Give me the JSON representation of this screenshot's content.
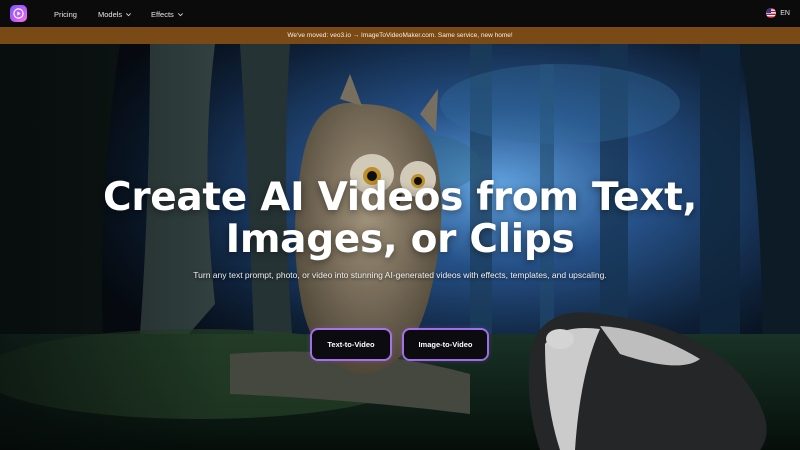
{
  "header": {
    "nav": {
      "pricing": "Pricing",
      "models": "Models",
      "effects": "Effects"
    },
    "language": "EN"
  },
  "banner": {
    "text": "We've moved: veo3.io → ImageToVideoMaker.com. Same service, new home!"
  },
  "hero": {
    "title_line1": "Create AI Videos from Text,",
    "title_line2": "Images, or Clips",
    "subtitle": "Turn any text prompt, photo, or video into stunning AI-generated videos with effects, templates, and upscaling.",
    "buttons": {
      "text_to_video": "Text-to-Video",
      "image_to_video": "Image-to-Video"
    }
  },
  "colors": {
    "banner_bg": "#7a4a16",
    "header_bg": "#0b0b0b",
    "button_border": "#b478ff"
  },
  "icons": {
    "logo": "play-logo-icon",
    "chevron": "chevron-down-icon",
    "flag": "us-flag-icon"
  }
}
